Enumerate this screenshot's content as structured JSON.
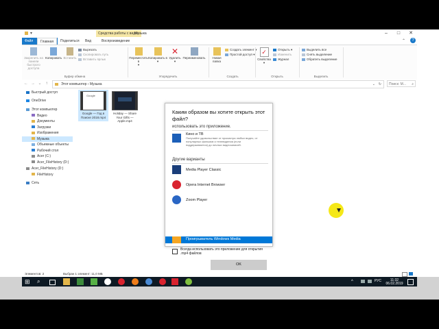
{
  "window": {
    "context_tab": "Средства работы с видео",
    "title": "Музыка"
  },
  "ribbon_tabs": [
    "Файл",
    "Главная",
    "Поделиться",
    "Вид",
    "Воспроизведение"
  ],
  "ribbon": {
    "clipboard": {
      "pin": "Закрепить на панели быстрого доступа",
      "copy": "Копировать",
      "paste": "Вставить",
      "cut": "Вырезать",
      "copy_path": "Скопировать путь",
      "paste_shortcut": "Вставить ярлык",
      "label": "Буфер обмена"
    },
    "organize": {
      "move": "Переместить в",
      "copy_to": "Копировать в",
      "delete": "Удалить",
      "rename": "Переименовать",
      "label": "Упорядочить"
    },
    "create": {
      "new_folder": "Новая папка",
      "new_item": "Создать элемент",
      "easy_access": "Простой доступ",
      "label": "Создать"
    },
    "open": {
      "properties": "Свойства",
      "open": "Открыть",
      "edit": "Изменить",
      "history": "Журнал",
      "label": "Открыть"
    },
    "select": {
      "select_all": "Выделить все",
      "select_none": "Снять выделение",
      "invert": "Обратить выделение",
      "label": "Выделить"
    }
  },
  "address": {
    "path": "Этот компьютер  ›  Музыка",
    "search_placeholder": "Поиск: М..."
  },
  "nav": {
    "items": [
      {
        "label": "Быстрый доступ",
        "indent": 0,
        "color": "#1a73c7"
      },
      {
        "label": "OneDrive",
        "indent": 0,
        "color": "#1c86e4"
      },
      {
        "label": "Этот компьютер",
        "indent": 0,
        "color": "#5a9bd5"
      },
      {
        "label": "Видео",
        "indent": 1,
        "color": "#8a6cc4"
      },
      {
        "label": "Документы",
        "indent": 1,
        "color": "#e2b54a"
      },
      {
        "label": "Загрузки",
        "indent": 1,
        "color": "#2a7fd4"
      },
      {
        "label": "Изображения",
        "indent": 1,
        "color": "#e2b54a"
      },
      {
        "label": "Музыка",
        "indent": 1,
        "color": "#e2b54a",
        "selected": true
      },
      {
        "label": "Объемные объекты",
        "indent": 1,
        "color": "#7db0e0"
      },
      {
        "label": "Рабочий стол",
        "indent": 1,
        "color": "#2a7fd4"
      },
      {
        "label": "Acer (C:)",
        "indent": 1,
        "color": "#8c8c8c"
      },
      {
        "label": "Acer_FileHistory (D:)",
        "indent": 1,
        "color": "#8c8c8c"
      },
      {
        "label": "Acer_FileHistory (D:)",
        "indent": 0,
        "color": "#8c8c8c"
      },
      {
        "label": "FileHistory",
        "indent": 1,
        "color": "#e2b54a"
      },
      {
        "label": "Сеть",
        "indent": 0,
        "color": "#3a7dc4"
      }
    ]
  },
  "files": [
    {
      "name": "Google — Год в Поиске 2018.mp4",
      "thumb_text": "Google",
      "selected": true
    },
    {
      "name": "Holiday — Share Your Gifts — Apple.mp4",
      "thumb_text": "",
      "selected": false
    }
  ],
  "status": {
    "count": "Элементов: 2",
    "selection": "Выбран 1 элемент: 11,0 МБ"
  },
  "dialog": {
    "title": "Каким образом вы хотите открыть этот файл?",
    "keep_using": "использовать это приложение.",
    "primary_app": {
      "name": "Кино и ТВ",
      "desc": "Получайте удовольствие от просмотра любых видео, от популярных фильмов и телевидения (если поддерживается) до личных видеозаписей."
    },
    "other_heading": "Другие варианты",
    "other_apps": [
      {
        "name": "Media Player Classic",
        "icon_color": "#1a3e7a"
      },
      {
        "name": "Opera Internet Browser",
        "icon_color": "#d9232f"
      },
      {
        "name": "Zoom Player",
        "icon_color": "#2a66c4"
      },
      {
        "name": "Проигрыватель Windows Media",
        "icon_color": "#f5a623"
      }
    ],
    "always_use": "Всегда использовать это приложение для открытия .mp4 файлов",
    "ok": "OK"
  },
  "taskbar": {
    "time": "11:32",
    "date": "06.02.2019",
    "lang": "РУС"
  },
  "colors": {
    "accent": "#1979ca",
    "selection": "#cce8ff",
    "dialog_highlight": "#0078d7",
    "taskbar": "#0e1a24",
    "cursor_halo": "#f5e600"
  }
}
